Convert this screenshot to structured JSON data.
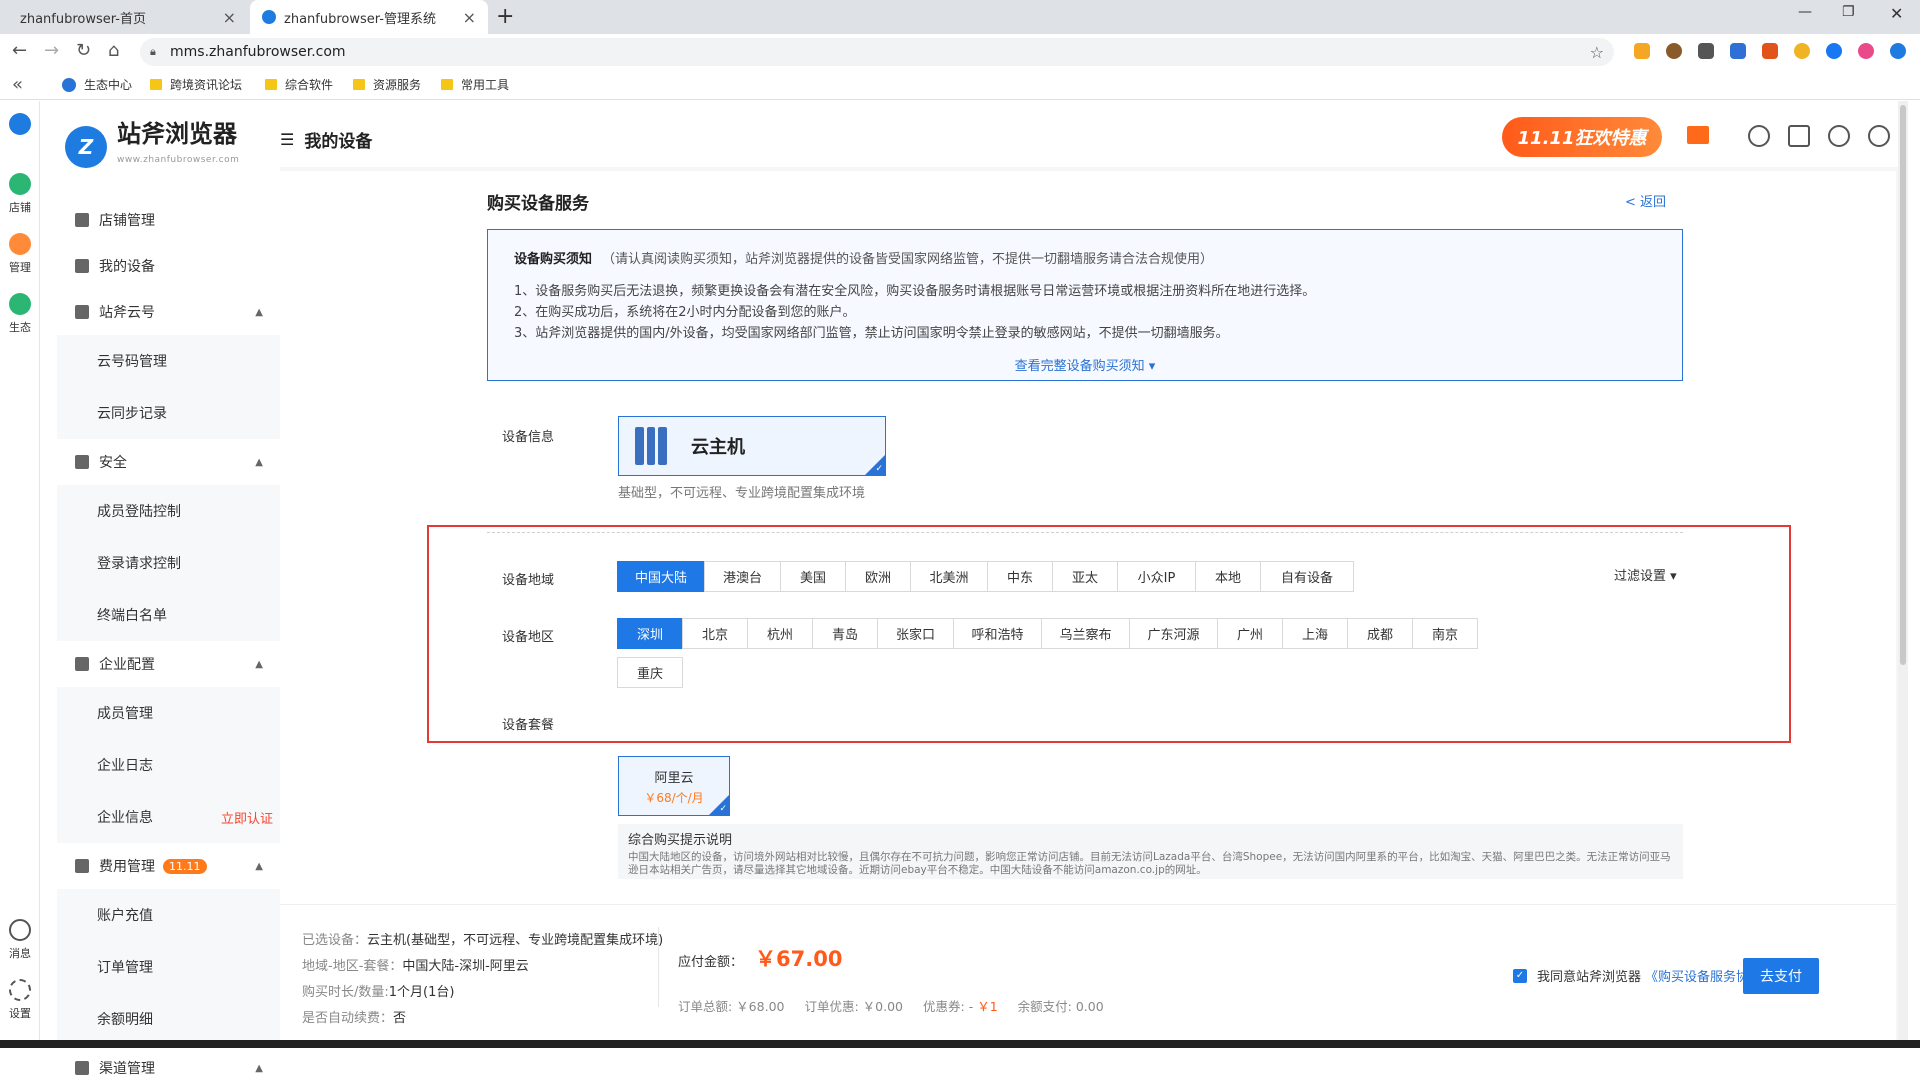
{
  "browser": {
    "tabs": [
      {
        "label": "zhanfubrowser-首页"
      },
      {
        "label": "zhanfubrowser-管理系统"
      }
    ],
    "url": "mms.zhanfubrowser.com",
    "bookmarks": [
      "生态中心",
      "跨境资讯论坛",
      "综合软件",
      "资源服务",
      "常用工具"
    ]
  },
  "rail": {
    "items": [
      "店铺",
      "管理",
      "生态",
      "消息",
      "设置"
    ]
  },
  "sidebar": {
    "logo_text": "站斧浏览器",
    "logo_sub": "www.zhanfubrowser.com",
    "groups": [
      {
        "label": "店铺管理"
      },
      {
        "label": "我的设备"
      },
      {
        "label": "站斧云号",
        "subs": [
          "云号码管理",
          "云同步记录"
        ]
      },
      {
        "label": "安全",
        "subs": [
          "成员登陆控制",
          "登录请求控制",
          "终端白名单"
        ]
      },
      {
        "label": "企业配置",
        "subs": [
          "成员管理",
          "企业日志",
          "企业信息"
        ]
      },
      {
        "label": "费用管理",
        "badge": "11.11",
        "subs": [
          "账户充值",
          "订单管理",
          "余额明细"
        ]
      },
      {
        "label": "渠道管理"
      }
    ],
    "certify": "立即认证"
  },
  "header": {
    "title": "我的设备",
    "promo": "11.11狂欢特惠"
  },
  "page": {
    "title": "购买设备服务",
    "back": "< 返回",
    "notice": {
      "head": "设备购买须知",
      "head_note": "（请认真阅读购买须知，站斧浏览器提供的设备皆受国家网络监管，不提供一切翻墙服务请合法合规使用）",
      "lines": [
        "1、设备服务购买后无法退换，频繁更换设备会有潜在安全风险，购买设备服务时请根据账号日常运营环境或根据注册资料所在地进行选择。",
        "2、在购买成功后，系统将在2小时内分配设备到您的账户。",
        "3、站斧浏览器提供的国内/外设备，均受国家网络部门监管，禁止访问国家明令禁止登录的敏感网站，不提供一切翻墙服务。"
      ],
      "more": "查看完整设备购买须知 ▾"
    },
    "device_info_label": "设备信息",
    "device_name": "云主机",
    "device_desc": "基础型，不可远程、专业跨境配置集成环境",
    "region_label": "设备地域",
    "regions": [
      "中国大陆",
      "港澳台",
      "美国",
      "欧洲",
      "北美洲",
      "中东",
      "亚太",
      "小众IP",
      "本地",
      "自有设备"
    ],
    "filter": "过滤设置 ▾",
    "area_label": "设备地区",
    "areas": [
      "深圳",
      "北京",
      "杭州",
      "青岛",
      "张家口",
      "呼和浩特",
      "乌兰察布",
      "广东河源",
      "广州",
      "上海",
      "成都",
      "南京"
    ],
    "areas_row2": [
      "重庆"
    ],
    "plan_label": "设备套餐",
    "plan_name": "阿里云",
    "plan_price": "￥68/个/月",
    "tips_title": "综合购买提示说明",
    "tips_text": "中国大陆地区的设备，访问境外网站相对比较慢，且偶尔存在不可抗力问题，影响您正常访问店铺。目前无法访问Lazada平台、台湾Shopee，无法访问国内阿里系的平台，比如淘宝、天猫、阿里巴巴之类。无法正常访问亚马逊日本站相关广告页，请尽量选择其它地域设备。近期访问ebay平台不稳定。中国大陆设备不能访问amazon.co.jp的网址。"
  },
  "footer": {
    "selected_label": "已选设备：",
    "selected": "云主机(基础型，不可远程、专业跨境配置集成环境)",
    "region_label": "地域-地区-套餐：",
    "region": "中国大陆-深圳-阿里云",
    "duration_label": "购买时长/数量:",
    "duration": "1个月(1台)",
    "auto_label": "是否自动续费：",
    "auto": "否",
    "due_label": "应付金额：",
    "due": "￥67.00",
    "total": "订单总额: ￥68.00",
    "discount": "订单优惠: ￥0.00",
    "coupon_label": "优惠券:",
    "coupon": "- ￥1",
    "balance": "余额支付: 0.00",
    "agree": "我同意站斧浏览器",
    "agreement": "《购买设备服务协议》",
    "pay": "去支付"
  }
}
